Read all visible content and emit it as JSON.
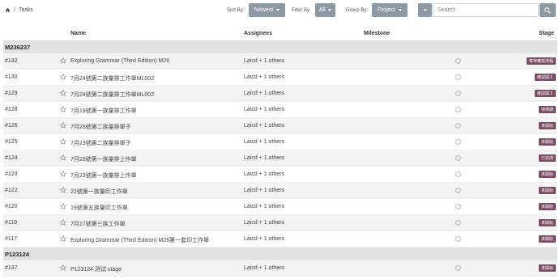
{
  "breadcrumb": {
    "page": "Tasks"
  },
  "filters": {
    "sort_label": "Sort By:",
    "sort_value": "Newest",
    "filter_label": "Filter By",
    "filter_value": "All",
    "group_label": "Group By:",
    "group_value": "Project"
  },
  "search": {
    "placeholder": "Search"
  },
  "columns": {
    "name": "Name",
    "assignees": "Assignees",
    "milestone": "Milestone",
    "stage": "Stage"
  },
  "groups": [
    {
      "title": "M236237",
      "rows": [
        {
          "id": "#132",
          "name": "Exploring Grammar (Third Edition) M26",
          "assignees": "Laicd + 1 others",
          "stage": "等待審核流程"
        },
        {
          "id": "#130",
          "name": "7月24號第二族量排工作單ML002",
          "assignees": "Laicd + 1 others",
          "stage": "確認開工"
        },
        {
          "id": "#129",
          "name": "7月24號第二族量排工作單ML002",
          "assignees": "Laicd + 1 others",
          "stage": "確認開工"
        },
        {
          "id": "#128",
          "name": "7月19號第一族量排工作單",
          "assignees": "Laicd + 1 others",
          "stage": "待排期"
        },
        {
          "id": "#126",
          "name": "7月23號第二族量排單子",
          "assignees": "Laicd + 1 others",
          "stage": "未開始"
        },
        {
          "id": "#125",
          "name": "7月23號第二族量排單子",
          "assignees": "Laicd + 1 others",
          "stage": "未開始"
        },
        {
          "id": "#124",
          "name": "7月23號第一族量排上作單",
          "assignees": "Laicd + 1 others",
          "stage": "已完成"
        },
        {
          "id": "#123",
          "name": "7月23號第一族量排上作單",
          "assignees": "Laicd + 1 others",
          "stage": "未開始"
        },
        {
          "id": "#122",
          "name": "22號第一族量印工作單",
          "assignees": "Laicd + 1 others",
          "stage": "未開始"
        },
        {
          "id": "#120",
          "name": "19號第五族量印工作單",
          "assignees": "Laicd + 1 others",
          "stage": "未開始"
        },
        {
          "id": "#119",
          "name": "7月17號第三族工作單",
          "assignees": "Laicd + 1 others",
          "stage": "未開始"
        },
        {
          "id": "#117",
          "name": "Exploring Grammar (Third Edition) M26第一套印工作單",
          "assignees": "Laicd + 1 others",
          "stage": "未開始"
        }
      ]
    },
    {
      "title": "P123124",
      "rows": [
        {
          "id": "#137",
          "name": "P123124 测试 stage",
          "assignees": "Laicd + 1 others",
          "stage": "未開始"
        }
      ]
    }
  ],
  "colors": {
    "accent": "#8e99a6",
    "stage_badge": "#7a4a62",
    "group_bg": "#e2e2e2"
  },
  "icons": [
    "home-icon",
    "search-icon",
    "star-icon",
    "chevron-down-icon",
    "milestone-circle-icon"
  ]
}
